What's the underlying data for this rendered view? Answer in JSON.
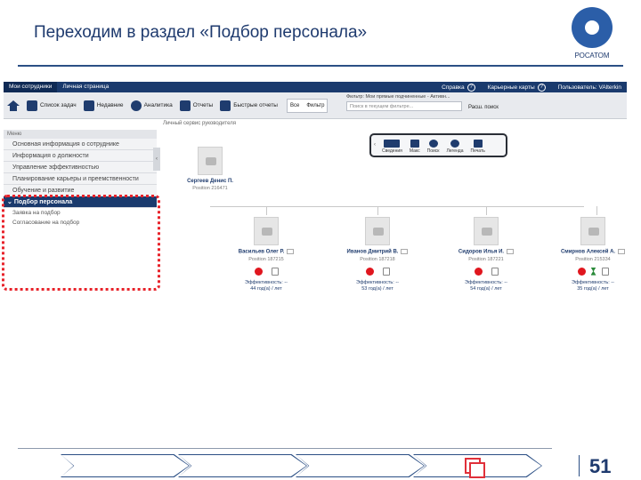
{
  "slide": {
    "title": "Переходим в раздел «Подбор персонала»",
    "logo_text": "РОСАТОМ",
    "page_number": "51"
  },
  "topbar": {
    "tabs": [
      "Мои сотрудники",
      "Личная страница"
    ],
    "help": "Справка",
    "career_maps": "Карьерные карты",
    "user": "Пользователь: VAlterkin"
  },
  "toolbar": {
    "tasks": "Список задач",
    "recent": "Недавние",
    "analytics": "Аналитика",
    "reports": "Отчеты",
    "quick_reports": "Быстрые отчеты",
    "all": "Все",
    "filter": "Фильтр",
    "filter_label": "Фильтр: Мои прямые подчиненные - Активн...",
    "filter_placeholder": "Поиск в текущем фильтре...",
    "ext_search": "Расш. поиск"
  },
  "breadcrumb": "Личный сервис руководителя",
  "menu": {
    "header": "Меню",
    "items": [
      "Основная информация о сотруднике",
      "Информация о должности",
      "Управление эффективностью",
      "Планирование карьеры и преемственности",
      "Обучение и развитие"
    ],
    "active": "Подбор персонала",
    "sub_items": [
      "Заявка на подбор",
      "Согласование на подбор"
    ]
  },
  "view_toolbar": [
    "Сведения",
    "Макс",
    "Поиск",
    "Легенда",
    "Печать"
  ],
  "manager": {
    "name": "Сергеев Денис П.",
    "position": "Position 216471"
  },
  "employees": [
    {
      "name": "Васильев Олег Р.",
      "position": "Position 187215",
      "eff": "Эффективность: --",
      "age": "44 год(а) / лет",
      "status": "exit"
    },
    {
      "name": "Иванов Дмитрий В.",
      "position": "Position 187218",
      "eff": "Эффективность: --",
      "age": "53 год(а) / лет",
      "status": "exit"
    },
    {
      "name": "Сидоров Илья И.",
      "position": "Position 187221",
      "eff": "Эффективность: --",
      "age": "54 год(а) / лет",
      "status": "exit"
    },
    {
      "name": "Смирнов Алексей А.",
      "position": "Position 215334",
      "eff": "Эффективность: --",
      "age": "35 год(а) / лет",
      "status": "hourglass"
    }
  ],
  "colors": {
    "accent": "#1a3a6d",
    "highlight": "#e8222a",
    "status_red": "#e0161e"
  }
}
